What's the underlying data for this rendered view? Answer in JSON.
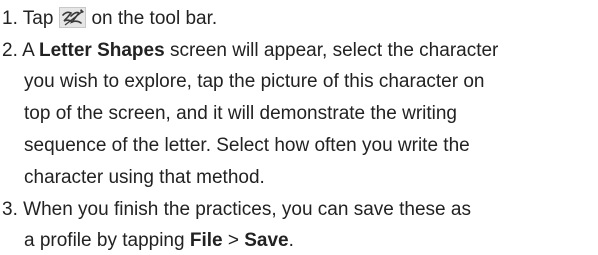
{
  "step1": {
    "number": "1.",
    "text_before": "Tap",
    "icon": "letter-shapes-tool-icon",
    "text_after": "on the tool bar."
  },
  "step2": {
    "number": "2.",
    "line1_a": "A",
    "line1_bold": "Letter Shapes",
    "line1_b": "screen will appear, select the character",
    "line2": "you wish to explore, tap the picture of this character on",
    "line3": "top of the screen, and it will demonstrate the writing",
    "line4": "sequence of the letter. Select how often you write the",
    "line5": "character using that method."
  },
  "step3": {
    "number": "3.",
    "line1": "When you finish the practices, you can save these as",
    "line2_a": "a profile by tapping",
    "file": "File",
    "sep": ">",
    "save": "Save",
    "period": "."
  }
}
